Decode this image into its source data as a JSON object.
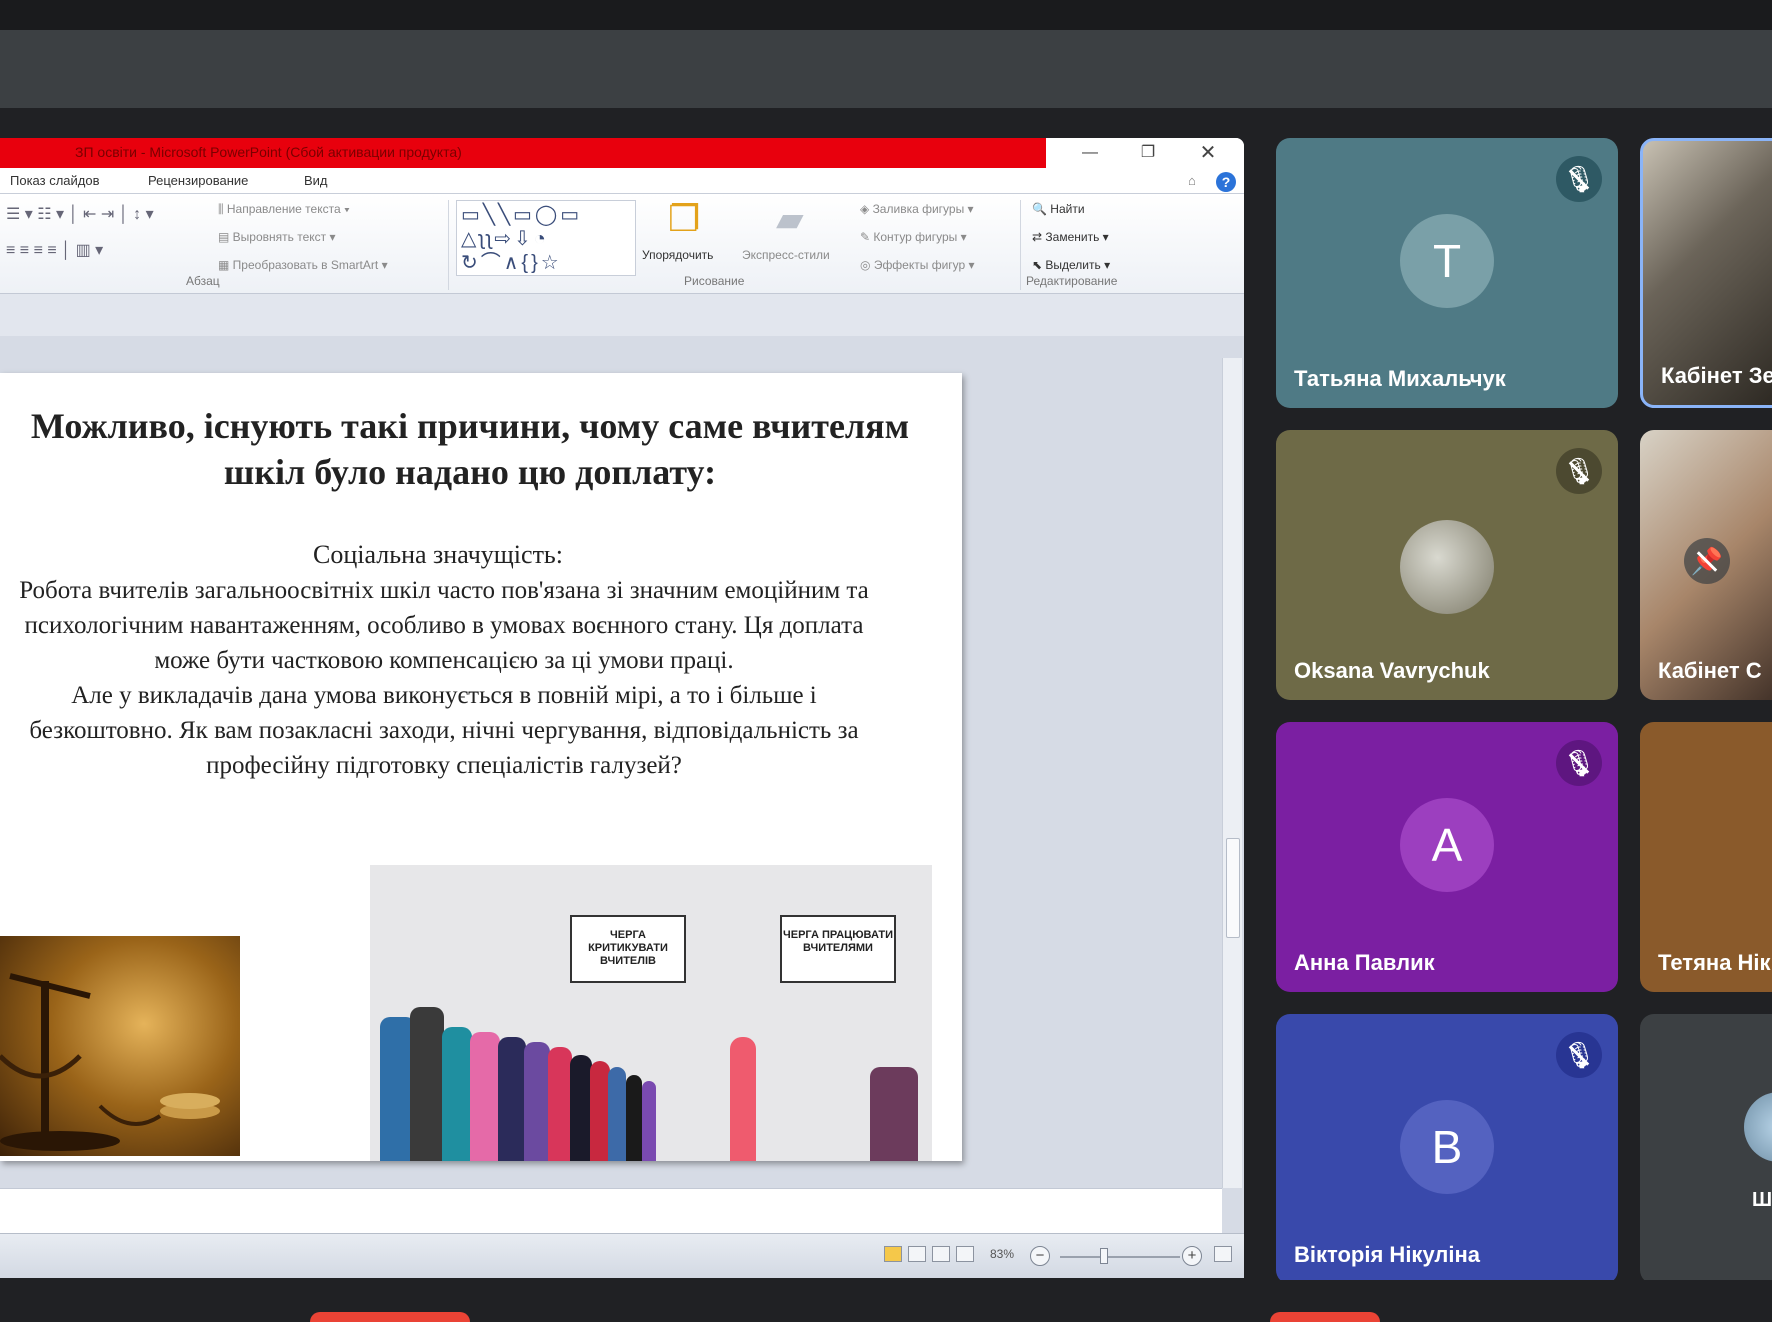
{
  "ppt": {
    "window_title": "ЗП освіти - Microsoft PowerPoint (Сбой активации продукта)",
    "tabs": [
      "Показ слайдов",
      "Рецензирование",
      "Вид"
    ],
    "ribbon": {
      "paragraph": {
        "text_direction": "Направление текста",
        "align_text": "Выровнять текст",
        "convert_smartart": "Преобразовать в SmartArt",
        "group_label": "Абзац"
      },
      "drawing": {
        "arrange": "Упорядочить",
        "quick_styles": "Экспресс-стили",
        "shape_fill": "Заливка фигуры",
        "shape_outline": "Контур фигуры",
        "shape_effects": "Эффекты фигур",
        "group_label": "Рисование"
      },
      "editing": {
        "find": "Найти",
        "replace": "Заменить",
        "select": "Выделить",
        "group_label": "Редактирование"
      }
    },
    "status": {
      "zoom": "83%"
    }
  },
  "slide": {
    "title_line1": "Можливо, існують такі причини, чому саме вчителям",
    "title_line2": "шкіл було надано цю доплату:",
    "subtitle": "Соціальна значущість:",
    "body_line1": "Робота вчителів загальноосвітніх шкіл часто пов'язана зі значним емоційним та",
    "body_line2": "психологічним навантаженням, особливо в умовах воєнного стану. Ця доплата",
    "body_line3": "може бути частковою компенсацією за ці умови праці.",
    "body_line4": "Але у викладачів дана умова виконується в повній мірі, а то і більше і",
    "body_line5": "безкоштовно. Як вам позакласні заходи, нічні чергування, відповідальність за",
    "body_line6": "професійну підготовку спеціалістів галузей?",
    "sign1": "ЧЕРГА КРИТИКУВАТИ ВЧИТЕЛІВ",
    "sign2": "ЧЕРГА ПРАЦЮВАТИ ВЧИТЕЛЯМИ"
  },
  "participants": [
    {
      "name": "Татьяна Михальчук",
      "initial": "T",
      "color": "#4f7a85"
    },
    {
      "name": "Кабінет Зе"
    },
    {
      "name": "Oksana Vavrychuk",
      "color": "#6e6a47"
    },
    {
      "name": "Кабінет С"
    },
    {
      "name": "Анна Павлик",
      "initial": "A",
      "color": "#7b1fa2"
    },
    {
      "name": "Тетяна Нік"
    },
    {
      "name": "Вікторія Нікуліна",
      "initial": "B",
      "color": "#3949ab"
    },
    {
      "name": "Ш"
    }
  ]
}
